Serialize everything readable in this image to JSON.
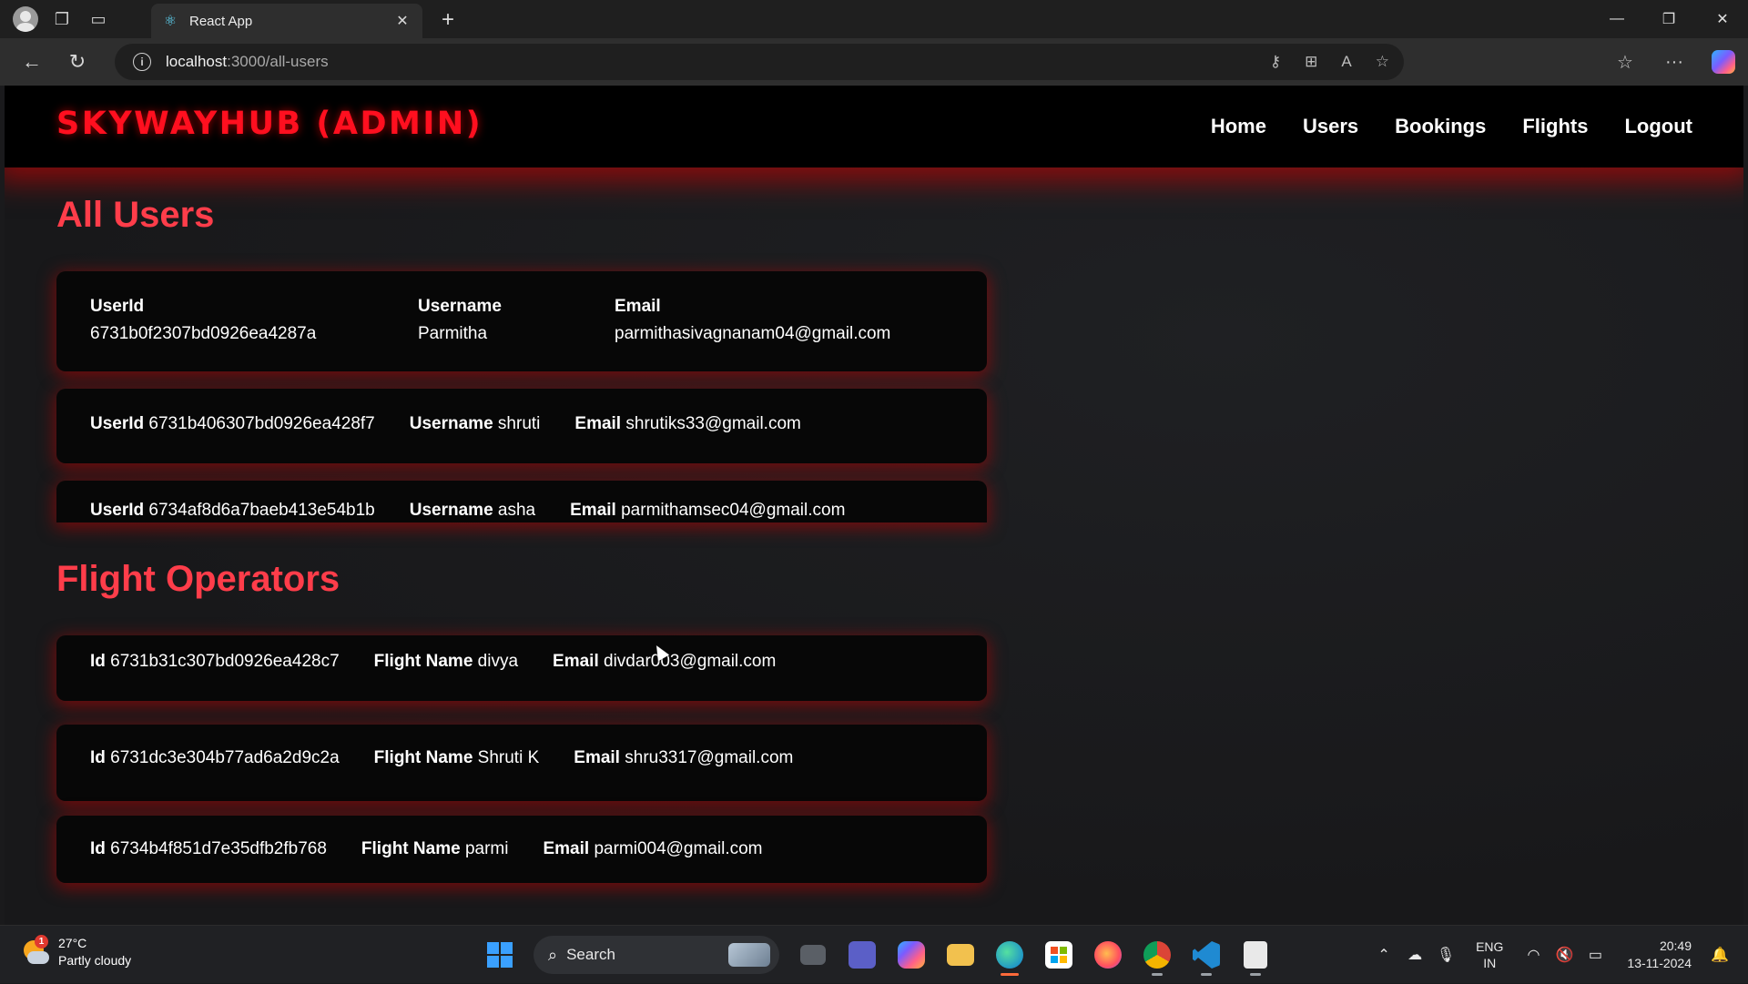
{
  "browser": {
    "tab_title": "React App",
    "url_host": "localhost",
    "url_path": ":3000/all-users"
  },
  "navbar": {
    "brand": "SKYWAYHUB (ADMIN)",
    "links": [
      "Home",
      "Users",
      "Bookings",
      "Flights",
      "Logout"
    ]
  },
  "users_section": {
    "title": "All Users",
    "users": [
      {
        "userid_label": "UserId",
        "userid": "6731b0f2307bd0926ea4287a",
        "username_label": "Username",
        "username": "Parmitha",
        "email_label": "Email",
        "email": "parmithasivagnanam04@gmail.com"
      },
      {
        "userid_label": "UserId",
        "userid": "6731b406307bd0926ea428f7",
        "username_label": "Username",
        "username": "shruti",
        "email_label": "Email",
        "email": "shrutiks33@gmail.com"
      },
      {
        "userid_label": "UserId",
        "userid": "6734af8d6a7baeb413e54b1b",
        "username_label": "Username",
        "username": "asha",
        "email_label": "Email",
        "email": "parmithamsec04@gmail.com"
      }
    ]
  },
  "operators_section": {
    "title": "Flight Operators",
    "operators": [
      {
        "id_label": "Id",
        "id": "6731b31c307bd0926ea428c7",
        "name_label": "Flight Name",
        "name": "divya",
        "email_label": "Email",
        "email": "divdar003@gmail.com"
      },
      {
        "id_label": "Id",
        "id": "6731dc3e304b77ad6a2d9c2a",
        "name_label": "Flight Name",
        "name": "Shruti K",
        "email_label": "Email",
        "email": "shru3317@gmail.com"
      },
      {
        "id_label": "Id",
        "id": "6734b4f851d7e35dfb2fb768",
        "name_label": "Flight Name",
        "name": "parmi",
        "email_label": "Email",
        "email": "parmi004@gmail.com"
      }
    ]
  },
  "taskbar": {
    "weather_badge": "1",
    "weather_temp": "27°C",
    "weather_desc": "Partly cloudy",
    "search_label": "Search",
    "lang_line1": "ENG",
    "lang_line2": "IN",
    "time": "20:49",
    "date": "13-11-2024"
  },
  "colors": {
    "brand_red": "#ff0f1f",
    "section_title": "#ff3d4a",
    "card_bg": "#070707",
    "navbar_bg": "#000000"
  }
}
